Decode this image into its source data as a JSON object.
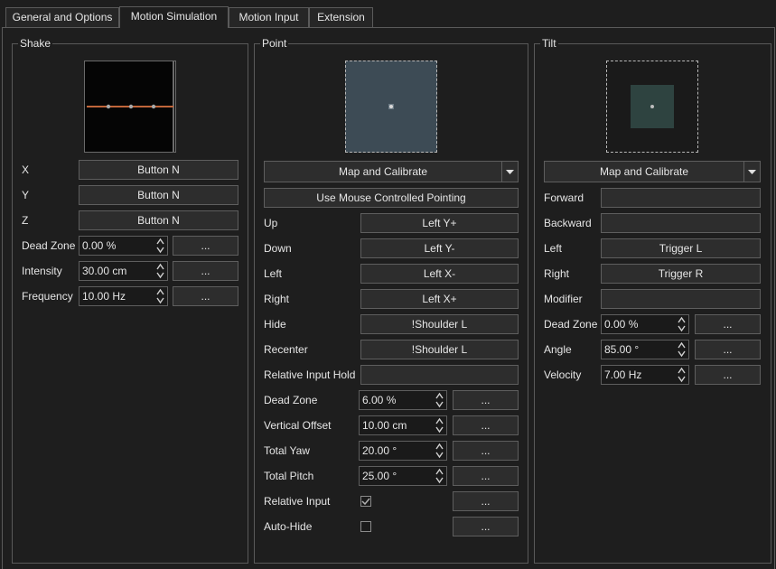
{
  "tabs": [
    "General and Options",
    "Motion Simulation",
    "Motion Input",
    "Extension"
  ],
  "shake": {
    "title": "Shake",
    "labels": {
      "x": "X",
      "y": "Y",
      "z": "Z",
      "dead_zone": "Dead Zone",
      "intensity": "Intensity",
      "frequency": "Frequency"
    },
    "x_button": "Button N",
    "y_button": "Button N",
    "z_button": "Button N",
    "dead_zone": "0.00 %",
    "intensity": "30.00 cm",
    "frequency": "10.00 Hz",
    "more": "..."
  },
  "point": {
    "title": "Point",
    "map_calibrate": "Map and Calibrate",
    "mouse_pointing": "Use Mouse Controlled Pointing",
    "labels": {
      "up": "Up",
      "down": "Down",
      "left": "Left",
      "right": "Right",
      "hide": "Hide",
      "recenter": "Recenter",
      "relative_input_hold": "Relative Input Hold",
      "dead_zone": "Dead Zone",
      "vertical_offset": "Vertical Offset",
      "total_yaw": "Total Yaw",
      "total_pitch": "Total Pitch",
      "relative_input": "Relative Input",
      "auto_hide": "Auto-Hide"
    },
    "up": "Left Y+",
    "down": "Left Y-",
    "left": "Left X-",
    "right": "Left X+",
    "hide": "!Shoulder L",
    "recenter": "!Shoulder L",
    "relative_input_hold": "",
    "dead_zone": "6.00 %",
    "vertical_offset": "10.00 cm",
    "total_yaw": "20.00 °",
    "total_pitch": "25.00 °",
    "relative_input_checked": true,
    "auto_hide_checked": false,
    "more": "..."
  },
  "tilt": {
    "title": "Tilt",
    "map_calibrate": "Map and Calibrate",
    "labels": {
      "forward": "Forward",
      "backward": "Backward",
      "left": "Left",
      "right": "Right",
      "modifier": "Modifier",
      "dead_zone": "Dead Zone",
      "angle": "Angle",
      "velocity": "Velocity"
    },
    "forward": "",
    "backward": "",
    "left": "Trigger L",
    "right": "Trigger R",
    "modifier": "",
    "dead_zone": "0.00 %",
    "angle": "85.00 °",
    "velocity": "7.00 Hz",
    "more": "..."
  },
  "colors": {
    "background": "#1e1e1e",
    "border": "#5a5a5a",
    "button": "#2d2d2d",
    "shake_line": "#c0653a",
    "point_preview": "#3d4b55",
    "tilt_preview": "#2e4340"
  }
}
